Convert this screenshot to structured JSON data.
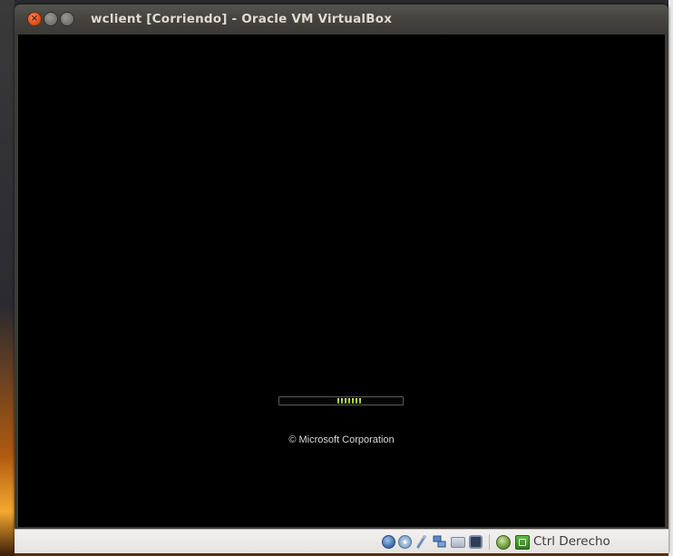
{
  "window": {
    "title": "wclient [Corriendo] - Oracle VM VirtualBox",
    "close_glyph": "×",
    "min_glyph": "–",
    "max_glyph": "□"
  },
  "vm_screen": {
    "background": "#000000",
    "boot_progress": {
      "style": "indeterminate marquee",
      "accent": "#9bd13a"
    },
    "copyright": "© Microsoft Corporation"
  },
  "status_bar": {
    "icons": [
      "hard-disk-icon",
      "optical-drive-icon",
      "usb-icon",
      "network-icon",
      "shared-folders-icon",
      "display-icon",
      "mouse-capture-icon",
      "host-key-icon"
    ],
    "host_key_label": "Ctrl Derecho"
  }
}
